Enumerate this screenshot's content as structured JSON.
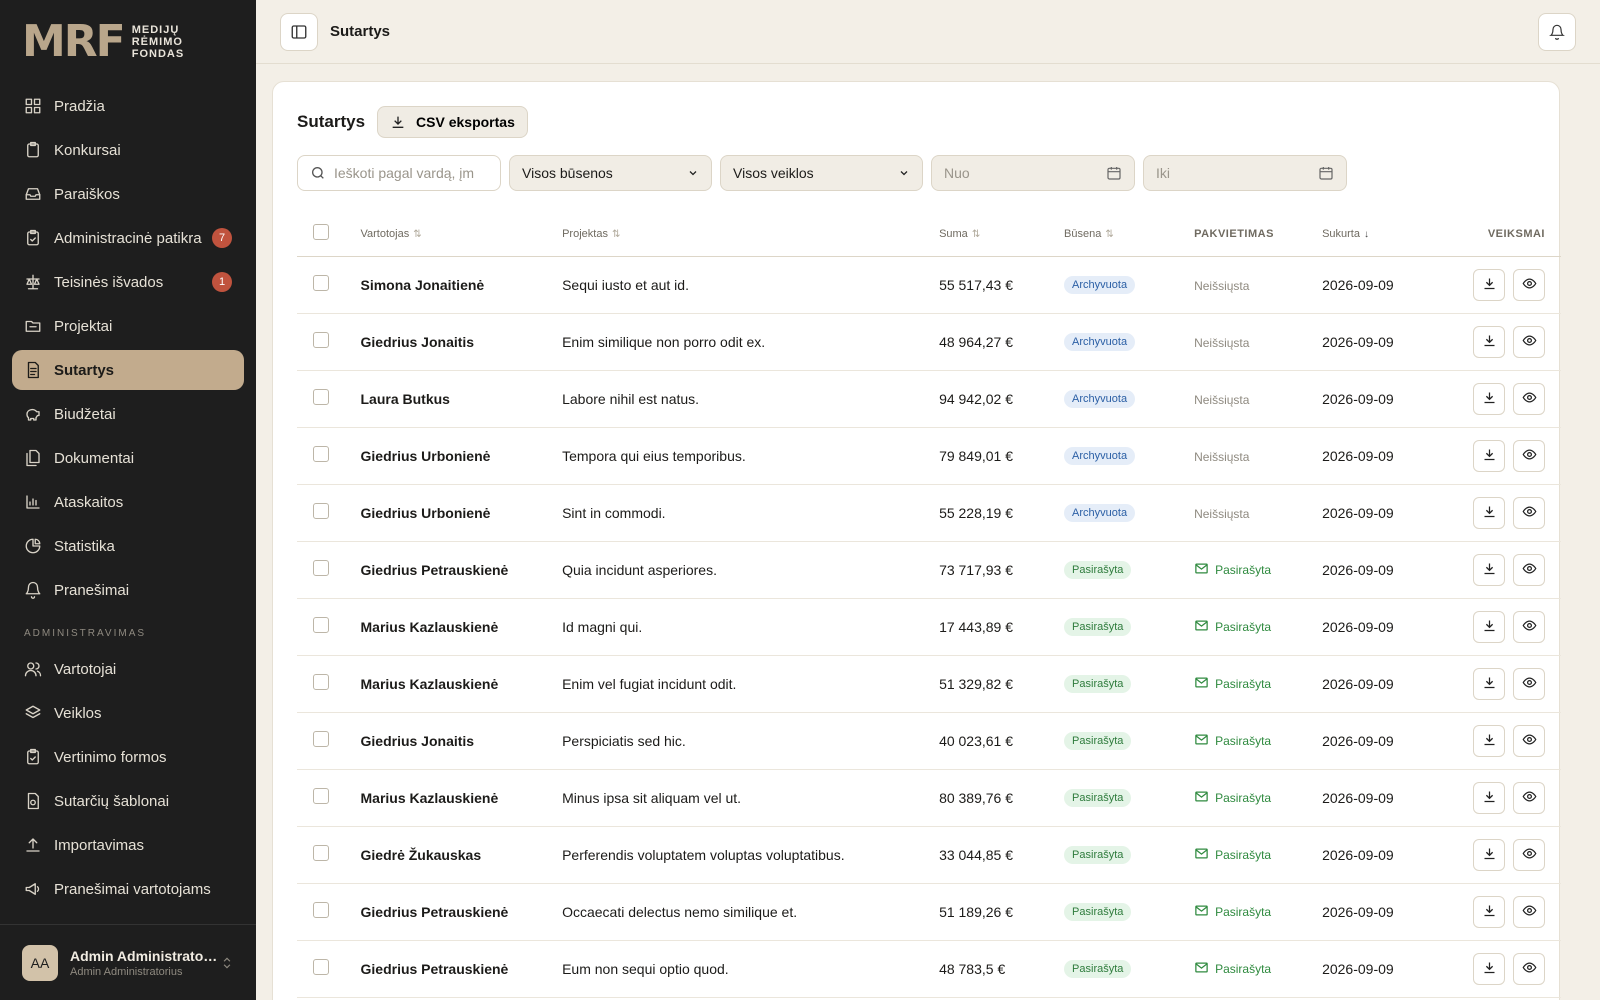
{
  "brand": {
    "mark": "MRF",
    "line1": "MEDIJŲ",
    "line2": "RĖMIMO",
    "line3": "FONDAS"
  },
  "nav": [
    {
      "label": "Pradžia",
      "icon": "grid-icon"
    },
    {
      "label": "Konkursai",
      "icon": "clipboard-icon"
    },
    {
      "label": "Paraiškos",
      "icon": "inbox-icon"
    },
    {
      "label": "Administracinė patikra",
      "icon": "clipboard-check-icon",
      "badge": "7"
    },
    {
      "label": "Teisinės išvados",
      "icon": "scale-icon",
      "badge": "1"
    },
    {
      "label": "Projektai",
      "icon": "folder-icon"
    },
    {
      "label": "Sutartys",
      "icon": "file-text-icon",
      "active": true
    },
    {
      "label": "Biudžetai",
      "icon": "piggy-bank-icon"
    },
    {
      "label": "Dokumentai",
      "icon": "files-icon"
    },
    {
      "label": "Ataskaitos",
      "icon": "bar-chart-icon"
    },
    {
      "label": "Statistika",
      "icon": "pie-chart-icon"
    },
    {
      "label": "Pranešimai",
      "icon": "bell-icon"
    }
  ],
  "admin_section": "ADMINISTRAVIMAS",
  "admin_nav": [
    {
      "label": "Vartotojai",
      "icon": "users-icon"
    },
    {
      "label": "Veiklos",
      "icon": "layers-icon"
    },
    {
      "label": "Vertinimo formos",
      "icon": "clipboard-check-icon"
    },
    {
      "label": "Sutarčių šablonai",
      "icon": "file-template-icon"
    },
    {
      "label": "Importavimas",
      "icon": "upload-icon"
    },
    {
      "label": "Pranešimai vartotojams",
      "icon": "megaphone-icon"
    }
  ],
  "user": {
    "initials": "AA",
    "name": "Admin Administratorius",
    "role": "Admin Administratorius"
  },
  "topbar": {
    "title": "Sutartys"
  },
  "page": {
    "title": "Sutartys",
    "csv_label": "CSV eksportas",
    "search_placeholder": "Ieškoti pagal vardą, įm",
    "status_select": "Visos būsenos",
    "activity_select": "Visos veiklos",
    "date_from": "Nuo",
    "date_to": "Iki"
  },
  "columns": {
    "user": "Vartotojas",
    "project": "Projektas",
    "amount": "Suma",
    "status": "Būsena",
    "invite": "Pakvietimas",
    "created": "Sukurta",
    "actions": "Veiksmai"
  },
  "rows": [
    {
      "user": "Simona Jonaitienė",
      "project": "Sequi iusto et aut id.",
      "amount": "55 517,43 €",
      "status": "Archyvuota",
      "status_kind": "arch",
      "invite": "Neišsiųsta",
      "invite_kind": "notsent",
      "created": "2026-09-09"
    },
    {
      "user": "Giedrius Jonaitis",
      "project": "Enim similique non porro odit ex.",
      "amount": "48 964,27 €",
      "status": "Archyvuota",
      "status_kind": "arch",
      "invite": "Neišsiųsta",
      "invite_kind": "notsent",
      "created": "2026-09-09"
    },
    {
      "user": "Laura Butkus",
      "project": "Labore nihil est natus.",
      "amount": "94 942,02 €",
      "status": "Archyvuota",
      "status_kind": "arch",
      "invite": "Neišsiųsta",
      "invite_kind": "notsent",
      "created": "2026-09-09"
    },
    {
      "user": "Giedrius Urbonienė",
      "project": "Tempora qui eius temporibus.",
      "amount": "79 849,01 €",
      "status": "Archyvuota",
      "status_kind": "arch",
      "invite": "Neišsiųsta",
      "invite_kind": "notsent",
      "created": "2026-09-09"
    },
    {
      "user": "Giedrius Urbonienė",
      "project": "Sint in commodi.",
      "amount": "55 228,19 €",
      "status": "Archyvuota",
      "status_kind": "arch",
      "invite": "Neišsiųsta",
      "invite_kind": "notsent",
      "created": "2026-09-09"
    },
    {
      "user": "Giedrius Petrauskienė",
      "project": "Quia incidunt asperiores.",
      "amount": "73 717,93 €",
      "status": "Pasirašyta",
      "status_kind": "sign",
      "invite": "Pasirašyta",
      "invite_kind": "signed",
      "created": "2026-09-09"
    },
    {
      "user": "Marius Kazlauskienė",
      "project": "Id magni qui.",
      "amount": "17 443,89 €",
      "status": "Pasirašyta",
      "status_kind": "sign",
      "invite": "Pasirašyta",
      "invite_kind": "signed",
      "created": "2026-09-09"
    },
    {
      "user": "Marius Kazlauskienė",
      "project": "Enim vel fugiat incidunt odit.",
      "amount": "51 329,82 €",
      "status": "Pasirašyta",
      "status_kind": "sign",
      "invite": "Pasirašyta",
      "invite_kind": "signed",
      "created": "2026-09-09"
    },
    {
      "user": "Giedrius Jonaitis",
      "project": "Perspiciatis sed hic.",
      "amount": "40 023,61 €",
      "status": "Pasirašyta",
      "status_kind": "sign",
      "invite": "Pasirašyta",
      "invite_kind": "signed",
      "created": "2026-09-09"
    },
    {
      "user": "Marius Kazlauskienė",
      "project": "Minus ipsa sit aliquam vel ut.",
      "amount": "80 389,76 €",
      "status": "Pasirašyta",
      "status_kind": "sign",
      "invite": "Pasirašyta",
      "invite_kind": "signed",
      "created": "2026-09-09"
    },
    {
      "user": "Giedrė Žukauskas",
      "project": "Perferendis voluptatem voluptas voluptatibus.",
      "amount": "33 044,85 €",
      "status": "Pasirašyta",
      "status_kind": "sign",
      "invite": "Pasirašyta",
      "invite_kind": "signed",
      "created": "2026-09-09"
    },
    {
      "user": "Giedrius Petrauskienė",
      "project": "Occaecati delectus nemo similique et.",
      "amount": "51 189,26 €",
      "status": "Pasirašyta",
      "status_kind": "sign",
      "invite": "Pasirašyta",
      "invite_kind": "signed",
      "created": "2026-09-09"
    },
    {
      "user": "Giedrius Petrauskienė",
      "project": "Eum non sequi optio quod.",
      "amount": "48 783,5 €",
      "status": "Pasirašyta",
      "status_kind": "sign",
      "invite": "Pasirašyta",
      "invite_kind": "signed",
      "created": "2026-09-09"
    }
  ],
  "colors": {
    "sidebar": "#1e1e1e",
    "accent": "#c2ab8d",
    "badge": "#c0533e",
    "archived": "#2b5fa5",
    "signed": "#2f7c3d"
  }
}
